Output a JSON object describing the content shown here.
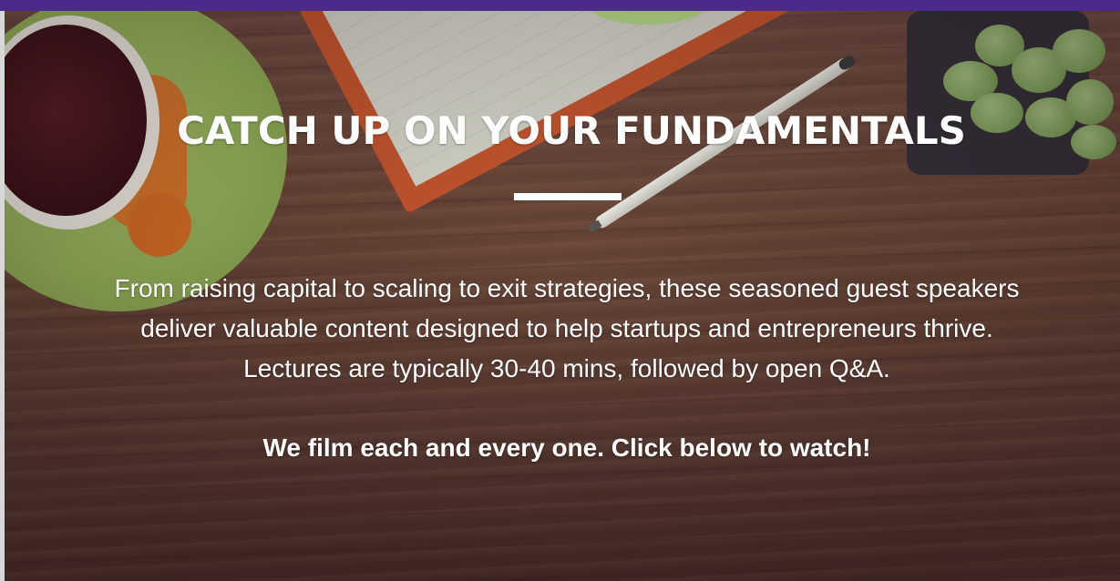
{
  "colors": {
    "top_bar": "#4b2a8a",
    "text": "#ffffff",
    "divider": "#ffffff"
  },
  "hero": {
    "title": "CATCH UP ON YOUR FUNDAMENTALS",
    "description": "From raising capital to scaling to exit strategies, these seasoned guest speakers deliver valuable content designed to help startups and entrepreneurs thrive. Lectures are typically 30-40 mins, followed by open Q&A.",
    "cta": "We film each and every one. Click below to watch!"
  }
}
